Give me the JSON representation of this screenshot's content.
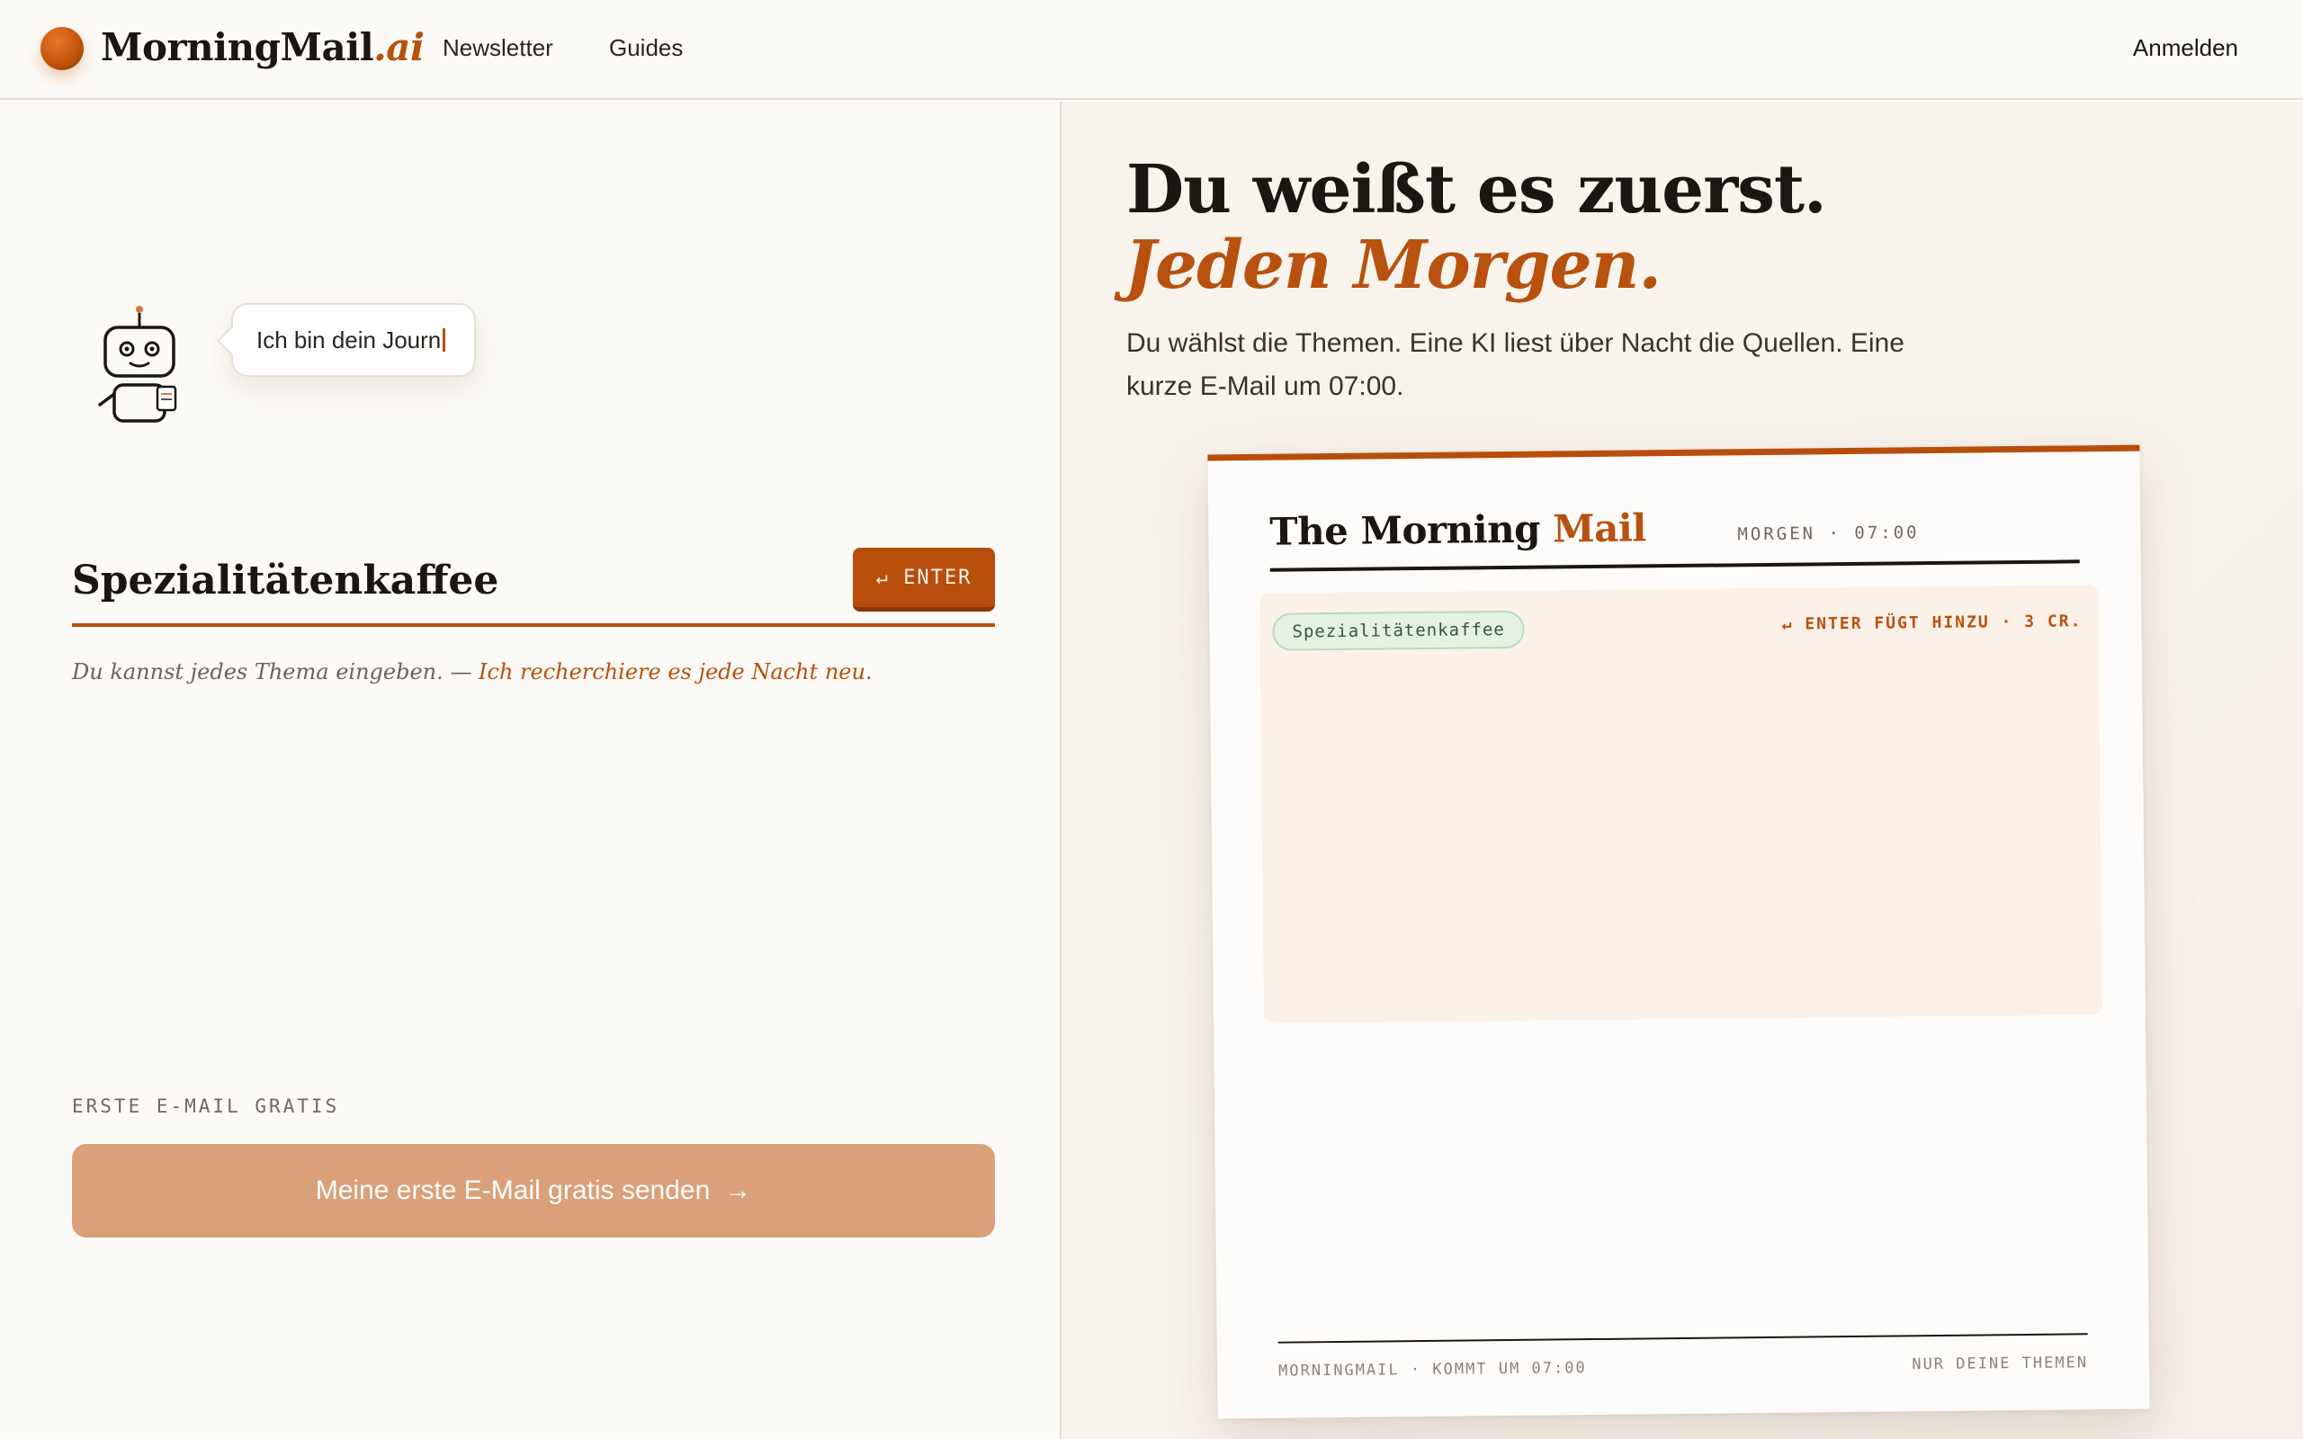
{
  "header": {
    "logo_main": "MorningMail",
    "logo_suffix": ".ai",
    "nav": [
      {
        "label": "Newsletter"
      },
      {
        "label": "Guides"
      }
    ],
    "signin_label": "Anmelden"
  },
  "left": {
    "bubble_text": "Ich bin dein Journ",
    "topic_value": "Spezialitätenkaffee",
    "enter_label": "↵ ENTER",
    "hint_prefix": "Du kannst jedes Thema eingeben. — ",
    "hint_accent": "Ich recherchiere es jede Nacht neu.",
    "free_label": "ERSTE E-MAIL GRATIS",
    "cta_label": "Meine erste E-Mail gratis senden",
    "cta_arrow": "→"
  },
  "right": {
    "headline": "Du weißt es zuerst.",
    "headline_accent": "Jeden Morgen.",
    "subtext": "Du wählst die Themen. Eine KI liest über Nacht die Quellen. Eine kurze E-Mail um 07:00.",
    "paper": {
      "title_main": "The Morning ",
      "title_accent": "Mail",
      "time": "MORGEN · 07:00",
      "tag": "Spezialitätenkaffee",
      "enter_note": "↵ ENTER FÜGT HINZU · 3 CR.",
      "footer_left": "MORNINGMAIL · KOMMT UM 07:00",
      "footer_right": "NUR DEINE THEMEN"
    }
  },
  "colors": {
    "accent": "#b8500e",
    "cta": "#d9a07a",
    "background": "#fcfaf6"
  },
  "icons": [
    "logo-ball-icon",
    "robot-icon",
    "enter-key-icon",
    "arrow-right-icon"
  ]
}
